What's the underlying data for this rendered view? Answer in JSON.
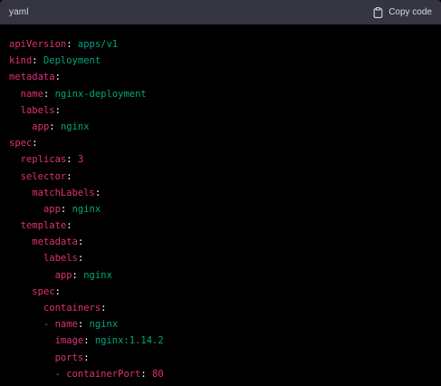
{
  "header": {
    "language": "yaml",
    "copy_label": "Copy code"
  },
  "colors": {
    "header_bg": "#343541",
    "code_bg": "#000000",
    "key": "#df3079",
    "string": "#00a67d",
    "number": "#df3079"
  },
  "icons": {
    "copy": "clipboard-icon"
  },
  "code_lines": [
    {
      "indent": "",
      "dash": "",
      "key": "apiVersion",
      "value": "apps/v1",
      "vtype": "string"
    },
    {
      "indent": "",
      "dash": "",
      "key": "kind",
      "value": "Deployment",
      "vtype": "string"
    },
    {
      "indent": "",
      "dash": "",
      "key": "metadata",
      "value": "",
      "vtype": "none"
    },
    {
      "indent": "  ",
      "dash": "",
      "key": "name",
      "value": "nginx-deployment",
      "vtype": "string"
    },
    {
      "indent": "  ",
      "dash": "",
      "key": "labels",
      "value": "",
      "vtype": "none"
    },
    {
      "indent": "    ",
      "dash": "",
      "key": "app",
      "value": "nginx",
      "vtype": "string"
    },
    {
      "indent": "",
      "dash": "",
      "key": "spec",
      "value": "",
      "vtype": "none"
    },
    {
      "indent": "  ",
      "dash": "",
      "key": "replicas",
      "value": "3",
      "vtype": "number"
    },
    {
      "indent": "  ",
      "dash": "",
      "key": "selector",
      "value": "",
      "vtype": "none"
    },
    {
      "indent": "    ",
      "dash": "",
      "key": "matchLabels",
      "value": "",
      "vtype": "none"
    },
    {
      "indent": "      ",
      "dash": "",
      "key": "app",
      "value": "nginx",
      "vtype": "string"
    },
    {
      "indent": "  ",
      "dash": "",
      "key": "template",
      "value": "",
      "vtype": "none"
    },
    {
      "indent": "    ",
      "dash": "",
      "key": "metadata",
      "value": "",
      "vtype": "none"
    },
    {
      "indent": "      ",
      "dash": "",
      "key": "labels",
      "value": "",
      "vtype": "none"
    },
    {
      "indent": "        ",
      "dash": "",
      "key": "app",
      "value": "nginx",
      "vtype": "string"
    },
    {
      "indent": "    ",
      "dash": "",
      "key": "spec",
      "value": "",
      "vtype": "none"
    },
    {
      "indent": "      ",
      "dash": "",
      "key": "containers",
      "value": "",
      "vtype": "none"
    },
    {
      "indent": "      ",
      "dash": "- ",
      "key": "name",
      "value": "nginx",
      "vtype": "string"
    },
    {
      "indent": "        ",
      "dash": "",
      "key": "image",
      "value": "nginx:1.14.2",
      "vtype": "string"
    },
    {
      "indent": "        ",
      "dash": "",
      "key": "ports",
      "value": "",
      "vtype": "none"
    },
    {
      "indent": "        ",
      "dash": "- ",
      "key": "containerPort",
      "value": "80",
      "vtype": "number"
    }
  ]
}
